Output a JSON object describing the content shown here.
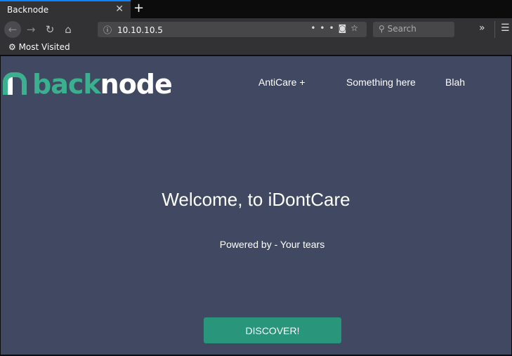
{
  "browser": {
    "tab_title": "Backnode",
    "url": "10.10.10.5",
    "search_placeholder": "Search",
    "bookmark": "Most Visited"
  },
  "site": {
    "logo_green": "back",
    "logo_white": "node",
    "nav": [
      "AntiCare +",
      "Something here",
      "Blah"
    ],
    "heading": "Welcome, to iDontCare",
    "subheading": "Powered by - Your tears",
    "cta": "DISCOVER!"
  },
  "colors": {
    "background": "#414962",
    "accent": "#29957a",
    "logo": "#3bb08f"
  }
}
